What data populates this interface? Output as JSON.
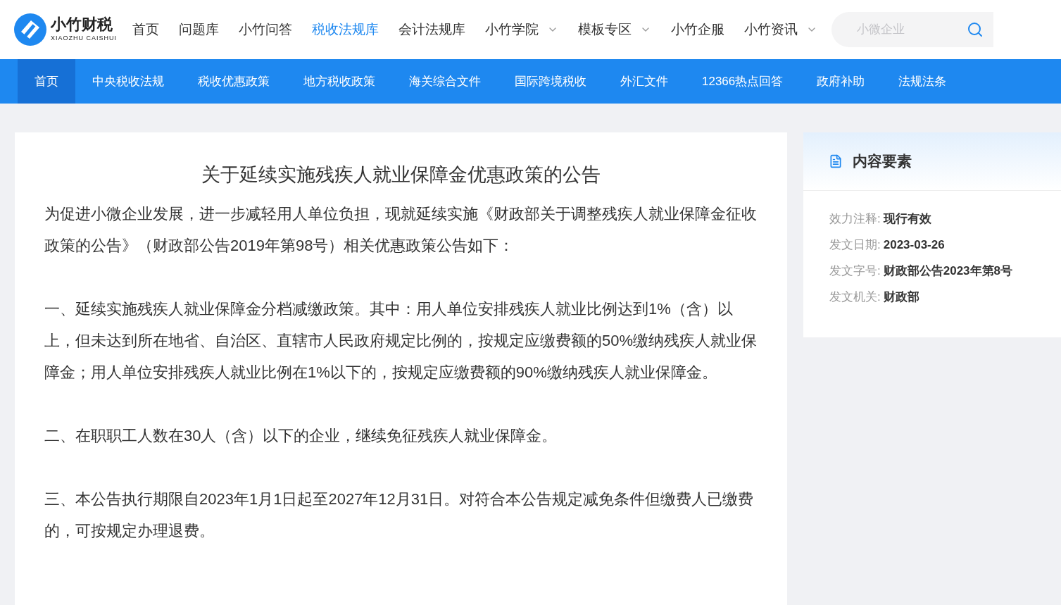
{
  "logo": {
    "name": "小竹财税",
    "subtitle": "XIAOZHU CAISHUI"
  },
  "top_nav": [
    {
      "label": "首页",
      "selected": false,
      "dropdown": false
    },
    {
      "label": "问题库",
      "selected": false,
      "dropdown": false
    },
    {
      "label": "小竹问答",
      "selected": false,
      "dropdown": false
    },
    {
      "label": "税收法规库",
      "selected": true,
      "dropdown": false
    },
    {
      "label": "会计法规库",
      "selected": false,
      "dropdown": false
    },
    {
      "label": "小竹学院",
      "selected": false,
      "dropdown": true
    },
    {
      "label": "模板专区",
      "selected": false,
      "dropdown": true
    },
    {
      "label": "小竹企服",
      "selected": false,
      "dropdown": false
    },
    {
      "label": "小竹资讯",
      "selected": false,
      "dropdown": true
    }
  ],
  "search": {
    "placeholder": "小微企业"
  },
  "sub_nav": [
    {
      "label": "首页",
      "selected": true
    },
    {
      "label": "中央税收法规",
      "selected": false
    },
    {
      "label": "税收优惠政策",
      "selected": false
    },
    {
      "label": "地方税收政策",
      "selected": false
    },
    {
      "label": "海关综合文件",
      "selected": false
    },
    {
      "label": "国际跨境税收",
      "selected": false
    },
    {
      "label": "外汇文件",
      "selected": false
    },
    {
      "label": "12366热点回答",
      "selected": false
    },
    {
      "label": "政府补助",
      "selected": false
    },
    {
      "label": "法规法条",
      "selected": false
    }
  ],
  "article": {
    "title": "关于延续实施残疾人就业保障金优惠政策的公告",
    "paragraphs": [
      "为促进小微企业发展，进一步减轻用人单位负担，现就延续实施《财政部关于调整残疾人就业保障金征收政策的公告》（财政部公告2019年第98号）相关优惠政策公告如下：",
      "一、延续实施残疾人就业保障金分档减缴政策。其中：用人单位安排残疾人就业比例达到1%（含）以上，但未达到所在地省、自治区、直辖市人民政府规定比例的，按规定应缴费额的50%缴纳残疾人就业保障金；用人单位安排残疾人就业比例在1%以下的，按规定应缴费额的90%缴纳残疾人就业保障金。",
      "二、在职职工人数在30人（含）以下的企业，继续免征残疾人就业保障金。",
      "三、本公告执行期限自2023年1月1日起至2027年12月31日。对符合本公告规定减免条件但缴费人已缴费的，可按规定办理退费。"
    ]
  },
  "sidebar": {
    "title": "内容要素",
    "fields": [
      {
        "label": "效力注释:",
        "value": "现行有效"
      },
      {
        "label": "发文日期:",
        "value": "2023-03-26"
      },
      {
        "label": "发文字号:",
        "value": "财政部公告2023年第8号"
      },
      {
        "label": "发文机关:",
        "value": "财政部"
      }
    ]
  }
}
